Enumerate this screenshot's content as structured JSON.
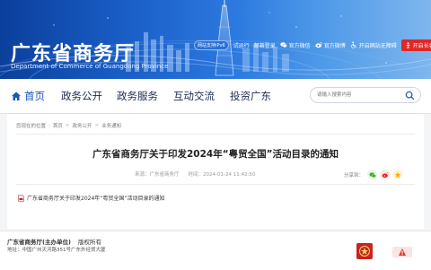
{
  "header": {
    "site_title": "广东省商务厅",
    "site_subtitle": "Department of Commerce of Guangdong Province",
    "ipv6_badge": "网站支持IPv6",
    "links": {
      "trial": "试运行",
      "email": "邮箱登录",
      "wechat": "官方微信",
      "weibo": "官方微博",
      "accessible": "开启网站无障碍",
      "elder": "开启长者助手"
    }
  },
  "nav": {
    "items": [
      "首页",
      "政务公开",
      "政务服务",
      "互动交流",
      "投资广东"
    ],
    "search_placeholder": "请输入搜索内容"
  },
  "breadcrumb": [
    "您现在的位置",
    "首页",
    "政务公开",
    "业务通知"
  ],
  "article": {
    "title": "广东省商务厅关于印发2024年“粤贸全国”活动目录的通知",
    "source_label": "来源：",
    "source": "广东省商务厅",
    "time_label": "时间：",
    "time": "2024-01-24 11:42:50",
    "share_label": "分享到：",
    "attachment": "广东省商务厅关于印发2024年“粤贸全国”活动目录的通知"
  },
  "footer": {
    "org": "广东省商务厅(主办单位)",
    "copyright": "版权所有",
    "address": "地址：中国广州天河路351号广东外经贸大厦"
  },
  "colors": {
    "brand_blue": "#1a56b8",
    "nav_text": "#1b2c52",
    "elder_red": "#e02727"
  }
}
